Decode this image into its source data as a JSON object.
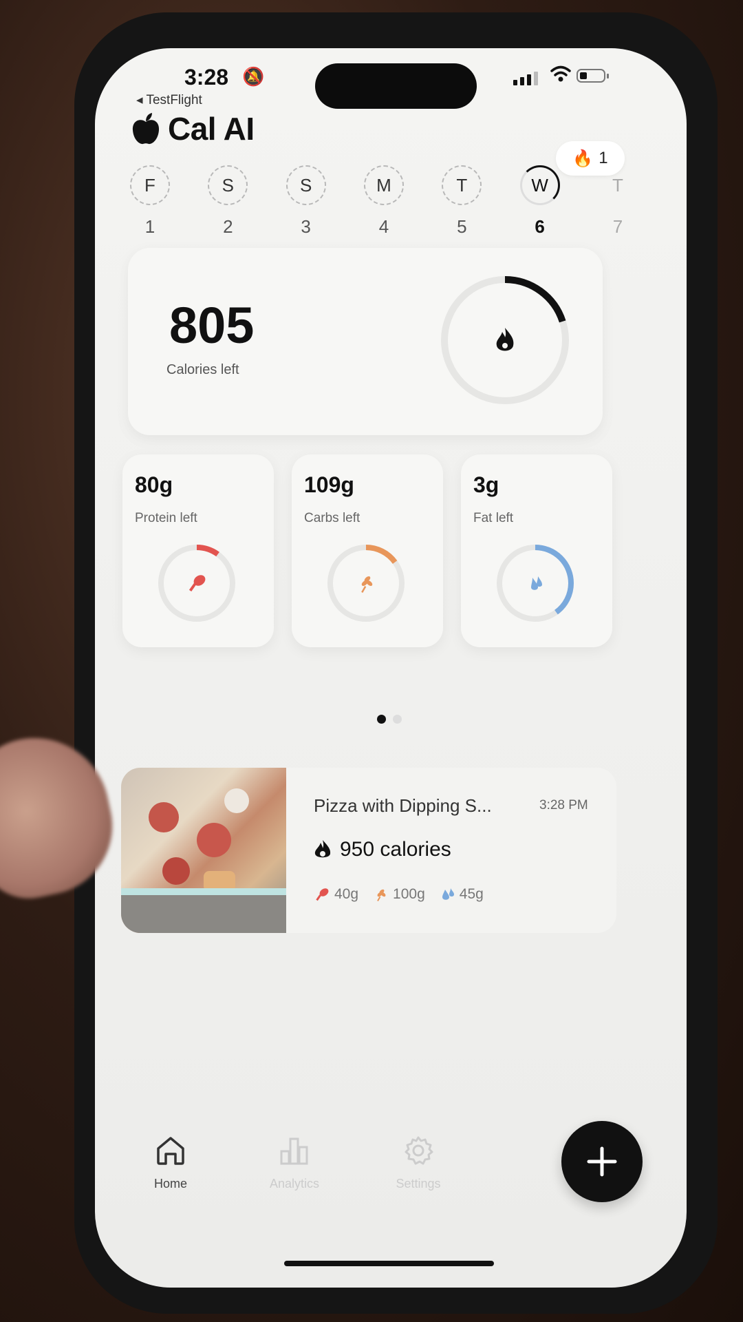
{
  "status_bar": {
    "time": "3:28",
    "back_app": "TestFlight"
  },
  "header": {
    "app_name": "Cal AI",
    "streak_count": "1"
  },
  "week": [
    {
      "letter": "F",
      "date": "1",
      "state": "past"
    },
    {
      "letter": "S",
      "date": "2",
      "state": "past"
    },
    {
      "letter": "S",
      "date": "3",
      "state": "past"
    },
    {
      "letter": "M",
      "date": "4",
      "state": "past"
    },
    {
      "letter": "T",
      "date": "5",
      "state": "past"
    },
    {
      "letter": "W",
      "date": "6",
      "state": "active"
    },
    {
      "letter": "T",
      "date": "7",
      "state": "future"
    }
  ],
  "calories": {
    "value": "805",
    "label": "Calories left",
    "progress": 0.2
  },
  "macros": [
    {
      "value": "80g",
      "label": "Protein left",
      "color": "#e2544f",
      "icon": "drumstick-icon",
      "progress": 0.1
    },
    {
      "value": "109g",
      "label": "Carbs left",
      "color": "#e8965a",
      "icon": "wheat-icon",
      "progress": 0.15
    },
    {
      "value": "3g",
      "label": "Fat left",
      "color": "#7aa9dc",
      "icon": "droplet-icon",
      "progress": 0.4
    }
  ],
  "meal": {
    "title": "Pizza with Dipping S...",
    "time": "3:28 PM",
    "calories": "950 calories",
    "protein": "40g",
    "carbs": "100g",
    "fat": "45g"
  },
  "nav": {
    "home": "Home",
    "analytics": "Analytics",
    "settings": "Settings"
  }
}
